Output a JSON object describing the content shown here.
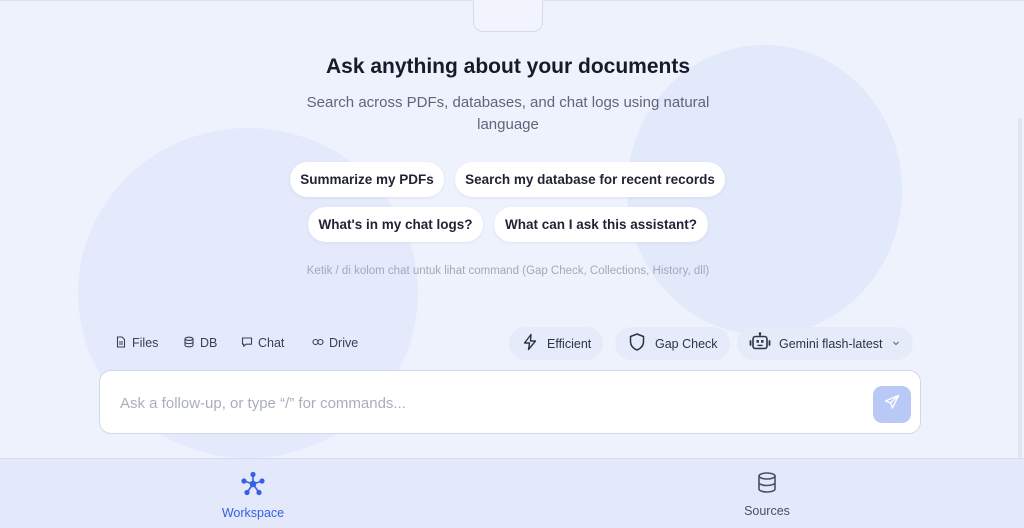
{
  "hero": {
    "title": "Ask anything about your documents",
    "subtitle": "Search across PDFs, databases, and chat logs using natural language"
  },
  "suggestions": [
    "Summarize my PDFs",
    "Search my database for recent records",
    "What's in my chat logs?",
    "What can I ask this assistant?"
  ],
  "hint": "Ketik / di kolom chat untuk lihat command (Gap Check, Collections, History, dll)",
  "sources": [
    {
      "label": "Files",
      "icon": "file-icon"
    },
    {
      "label": "DB",
      "icon": "database-icon"
    },
    {
      "label": "Chat",
      "icon": "chat-bubble-icon"
    },
    {
      "label": "Drive",
      "icon": "link-icon"
    }
  ],
  "modes": {
    "efficient": "Efficient",
    "gap_check": "Gap Check",
    "model": "Gemini flash-latest"
  },
  "composer": {
    "placeholder": "Ask a follow-up, or type “/” for commands..."
  },
  "nav": {
    "workspace": "Workspace",
    "sources": "Sources"
  },
  "colors": {
    "accent": "#3560e6",
    "background": "#eef2fd",
    "send_button": "#b9c9f6"
  }
}
